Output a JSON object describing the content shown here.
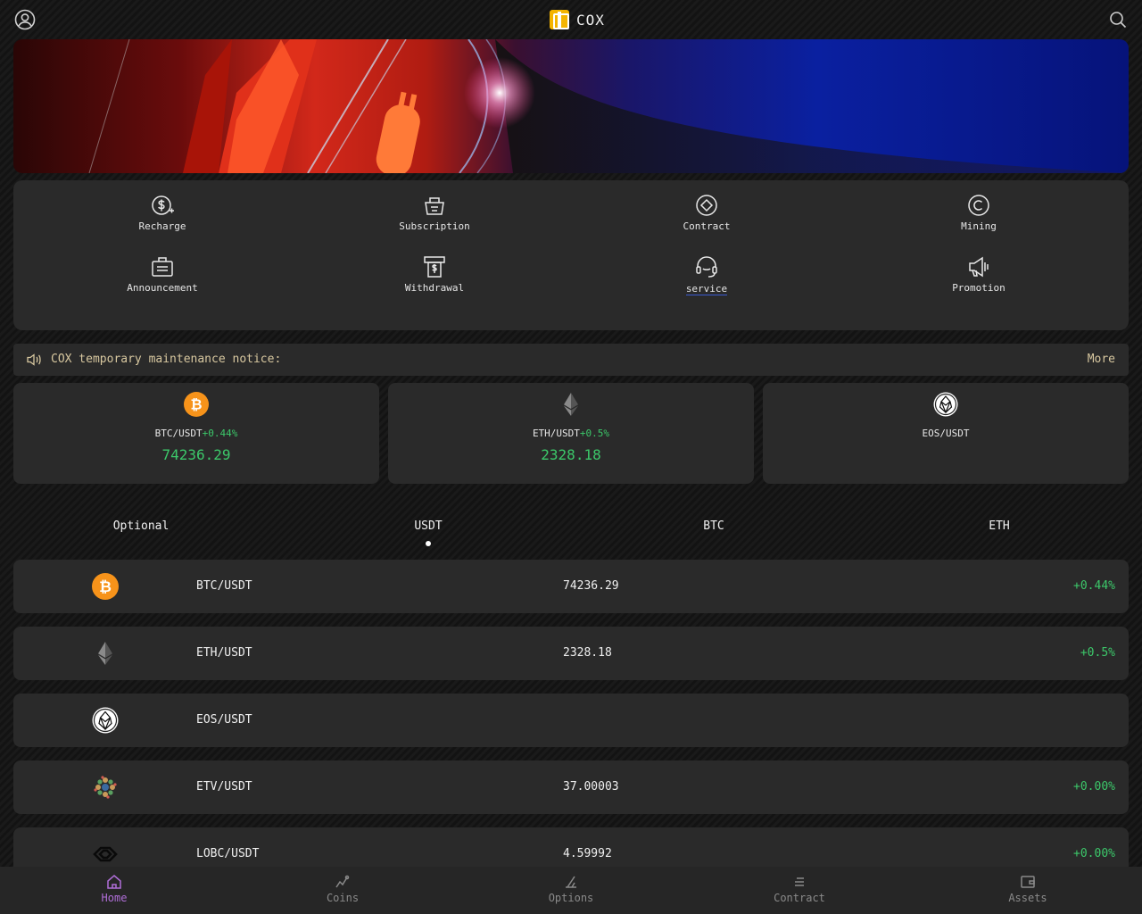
{
  "header": {
    "brand_name": "COX"
  },
  "menu": {
    "items": [
      {
        "label": "Recharge",
        "icon": "dollar-plus-icon"
      },
      {
        "label": "Subscription",
        "icon": "basket-icon"
      },
      {
        "label": "Contract",
        "icon": "diamond-circle-icon"
      },
      {
        "label": "Mining",
        "icon": "copyright-circle-icon"
      },
      {
        "label": "Announcement",
        "icon": "briefcase-icon"
      },
      {
        "label": "Withdrawal",
        "icon": "cash-withdraw-icon"
      },
      {
        "label": "service",
        "icon": "headset-icon"
      },
      {
        "label": "Promotion",
        "icon": "megaphone-icon"
      }
    ]
  },
  "notice": {
    "text": "COX temporary maintenance notice:",
    "more_label": "More"
  },
  "tickers": [
    {
      "pair": "BTC/USDT",
      "change": "+0.44%",
      "price": "74236.29",
      "icon": "bitcoin-icon"
    },
    {
      "pair": "ETH/USDT",
      "change": "+0.5%",
      "price": "2328.18",
      "icon": "ethereum-icon"
    },
    {
      "pair": "EOS/USDT",
      "change": "",
      "price": "",
      "icon": "eos-icon"
    }
  ],
  "tabs": [
    {
      "label": "Optional"
    },
    {
      "label": "USDT"
    },
    {
      "label": "BTC"
    },
    {
      "label": "ETH"
    }
  ],
  "active_tab": "USDT",
  "market_rows": [
    {
      "pair": "BTC/USDT",
      "price": "74236.29",
      "change": "+0.44%",
      "icon": "bitcoin-icon"
    },
    {
      "pair": "ETH/USDT",
      "price": "2328.18",
      "change": "+0.5%",
      "icon": "ethereum-icon"
    },
    {
      "pair": "EOS/USDT",
      "price": "",
      "change": "",
      "icon": "eos-icon"
    },
    {
      "pair": "ETV/USDT",
      "price": "37.00003",
      "change": "+0.00%",
      "icon": "etv-icon"
    },
    {
      "pair": "LOBC/USDT",
      "price": "4.59992",
      "change": "+0.00%",
      "icon": "lobc-icon"
    }
  ],
  "bottom_nav": [
    {
      "label": "Home",
      "icon": "home-icon"
    },
    {
      "label": "Coins",
      "icon": "coins-icon"
    },
    {
      "label": "Options",
      "icon": "options-icon"
    },
    {
      "label": "Contract",
      "icon": "contract-icon"
    },
    {
      "label": "Assets",
      "icon": "wallet-icon"
    }
  ],
  "active_nav": "Home",
  "colors": {
    "accent_purple": "#b06ed8",
    "positive_green": "#3cc86a",
    "notice_gold": "#d8c8a0",
    "panel": "#2a2a2a",
    "bitcoin_orange": "#f7931a",
    "brand_yellow": "#f4b400"
  }
}
